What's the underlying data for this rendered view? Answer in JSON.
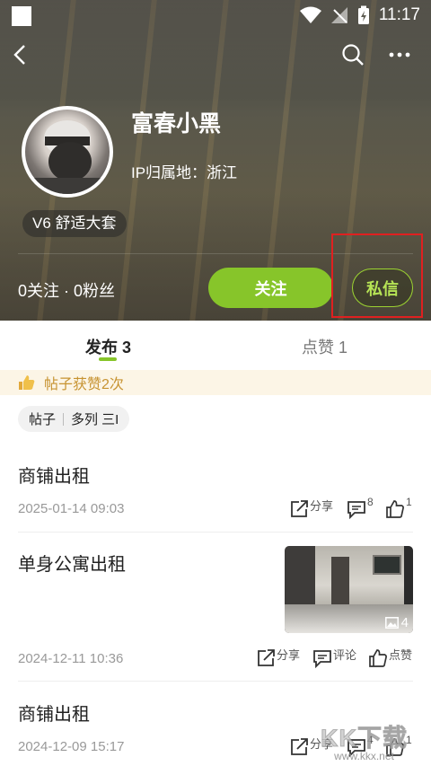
{
  "status_bar": {
    "time": "11:17"
  },
  "profile": {
    "name": "富春小黑",
    "ip_location": "IP归属地：浙江",
    "level_badge": "V6 舒适大套",
    "follow_stats": "0关注 · 0粉丝",
    "follow_button": "关注",
    "message_button": "私信"
  },
  "tabs": [
    {
      "label": "发布 3",
      "active": true
    },
    {
      "label": "点赞 1",
      "active": false
    }
  ],
  "likes_banner": "帖子获赞2次",
  "filter": {
    "option1": "帖子",
    "option2": "多列 三I"
  },
  "posts": [
    {
      "title": "商铺出租",
      "date": "2025-01-14 09:03",
      "share_label": "分享",
      "comment_count": "8",
      "like_count": "1"
    },
    {
      "title": "单身公寓出租",
      "date": "2024-12-11 10:36",
      "image_count": "4",
      "share_label": "分享",
      "comment_label": "评论",
      "like_label": "点赞"
    },
    {
      "title": "商铺出租",
      "date": "2024-12-09 15:17",
      "share_label": "分享",
      "comment_count": "4",
      "like_count": "1"
    }
  ],
  "watermark": {
    "big": "KK下载",
    "small": "www.kkx.net"
  },
  "colors": {
    "accent": "#87c52a",
    "highlight_box": "#e02020",
    "banner_text": "#c79331"
  }
}
